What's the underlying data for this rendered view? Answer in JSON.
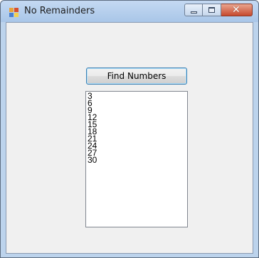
{
  "window": {
    "title": "No Remainders",
    "minimize_label": "",
    "maximize_label": "",
    "close_label": "✕"
  },
  "main": {
    "find_button_label": "Find Numbers",
    "results": [
      "3",
      "6",
      "9",
      "12",
      "15",
      "18",
      "21",
      "24",
      "27",
      "30"
    ]
  },
  "colors": {
    "titlebar": "#a9c6e8",
    "client_background": "#f0f0f0",
    "button_border": "#3c7fb1",
    "close_button": "#c74a2e"
  }
}
